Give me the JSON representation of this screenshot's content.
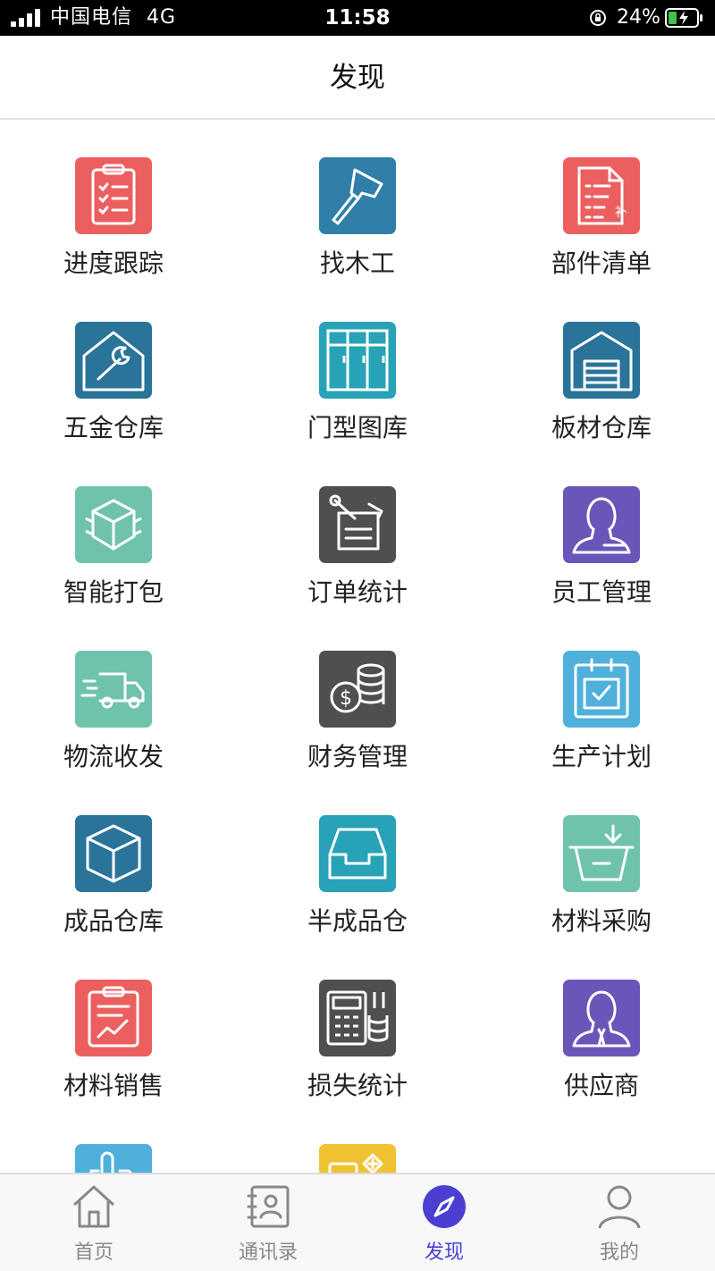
{
  "status_bar": {
    "carrier": "中国电信",
    "network": "4G",
    "time": "11:58",
    "battery": "24%"
  },
  "header": {
    "title": "发现"
  },
  "grid": {
    "items": [
      {
        "label": "进度跟踪",
        "icon": "clipboard-checklist-icon",
        "color": "#ec5f5f"
      },
      {
        "label": "找木工",
        "icon": "axe-icon",
        "color": "#2f7fa8"
      },
      {
        "label": "部件清单",
        "icon": "parts-list-icon",
        "color": "#ec5f5f"
      },
      {
        "label": "五金仓库",
        "icon": "wrench-house-icon",
        "color": "#2a7399"
      },
      {
        "label": "门型图库",
        "icon": "door-gallery-icon",
        "color": "#28a2b6"
      },
      {
        "label": "板材仓库",
        "icon": "warehouse-icon",
        "color": "#2a7399"
      },
      {
        "label": "智能打包",
        "icon": "package-box-icon",
        "color": "#6fc3ac"
      },
      {
        "label": "订单统计",
        "icon": "order-pin-icon",
        "color": "#4f4f4f"
      },
      {
        "label": "员工管理",
        "icon": "employee-icon",
        "color": "#6a56b8"
      },
      {
        "label": "物流收发",
        "icon": "delivery-truck-icon",
        "color": "#6fc3ac"
      },
      {
        "label": "财务管理",
        "icon": "coins-icon",
        "color": "#4f4f4f"
      },
      {
        "label": "生产计划",
        "icon": "calendar-check-icon",
        "color": "#4fb0dc"
      },
      {
        "label": "成品仓库",
        "icon": "cube-box-icon",
        "color": "#2a7399"
      },
      {
        "label": "半成品仓",
        "icon": "inbox-tray-icon",
        "color": "#28a2b6"
      },
      {
        "label": "材料采购",
        "icon": "basket-download-icon",
        "color": "#6fc3ac"
      },
      {
        "label": "材料销售",
        "icon": "sales-chart-icon",
        "color": "#ec5f5f"
      },
      {
        "label": "损失统计",
        "icon": "calculator-icon",
        "color": "#4f4f4f"
      },
      {
        "label": "供应商",
        "icon": "supplier-person-icon",
        "color": "#6a56b8"
      },
      {
        "label": "",
        "icon": "clip-document-icon",
        "color": "#4fb0dc"
      },
      {
        "label": "",
        "icon": "add-folder-icon",
        "color": "#f0c231"
      }
    ]
  },
  "tabs": [
    {
      "label": "首页",
      "icon": "home-icon"
    },
    {
      "label": "通讯录",
      "icon": "contacts-book-icon"
    },
    {
      "label": "发现",
      "icon": "compass-icon",
      "active": true
    },
    {
      "label": "我的",
      "icon": "user-icon"
    }
  ],
  "colors": {
    "accent": "#4a3fd1",
    "tab_inactive": "#888888",
    "status_bar_bg": "#000000",
    "battery_fill": "#3ec44a"
  }
}
